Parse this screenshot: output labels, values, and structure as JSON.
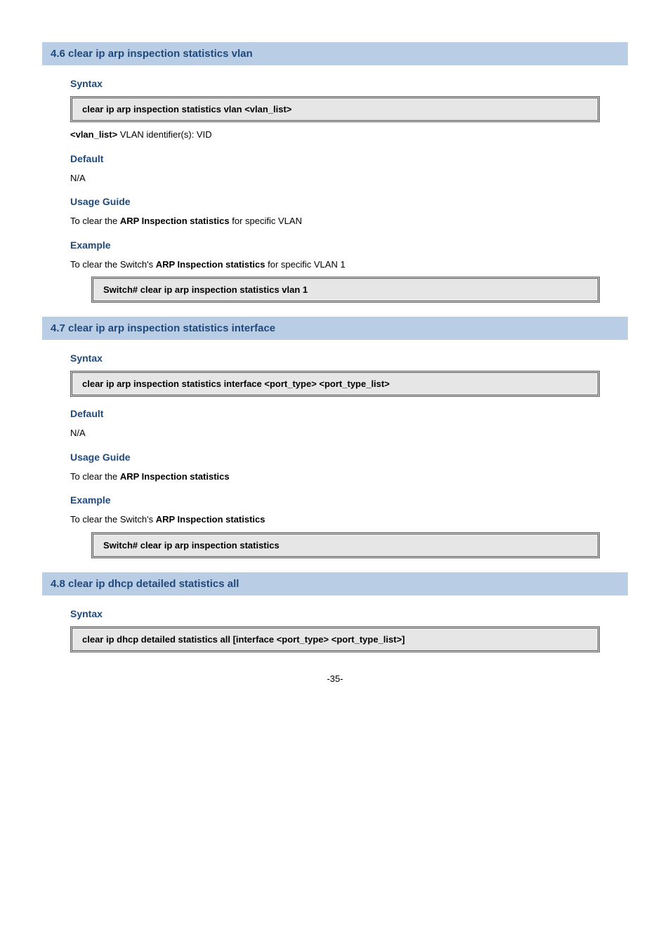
{
  "sec1": {
    "title": "4.6 clear ip arp inspection statistics vlan",
    "syntax_label": "Syntax",
    "cmd": "clear ip arp inspection statistics vlan <vlan_list>",
    "param_line_prefix": "<vlan_list>",
    "param_line_rest": " VLAN identifier(s): VID",
    "default_label": "Default",
    "default_val": "N/A",
    "usage_label": "Usage Guide",
    "usage_prefix": "To clear the ",
    "usage_bold": "ARP Inspection statistics",
    "usage_suffix": " for specific VLAN",
    "example_label": "Example",
    "example_prefix": "To clear the Switch's ",
    "example_bold": "ARP Inspection statistics",
    "example_suffix": " for specific VLAN 1",
    "example_cmd": "Switch# clear ip arp inspection statistics vlan 1"
  },
  "sec2": {
    "title": "4.7 clear ip arp inspection statistics interface",
    "syntax_label": "Syntax",
    "cmd": "clear ip arp inspection statistics interface <port_type> <port_type_list>",
    "default_label": "Default",
    "default_val": "N/A",
    "usage_label": "Usage Guide",
    "usage_prefix": "To clear the ",
    "usage_bold": "ARP Inspection statistics",
    "example_label": "Example",
    "example_prefix": "To clear the Switch's ",
    "example_bold": "ARP Inspection statistics",
    "example_cmd": "Switch# clear ip arp inspection statistics"
  },
  "sec3": {
    "title": "4.8 clear ip dhcp detailed statistics all",
    "syntax_label": "Syntax",
    "cmd": "clear ip dhcp detailed statistics all [interface <port_type> <port_type_list>]"
  },
  "footer": "-35-"
}
